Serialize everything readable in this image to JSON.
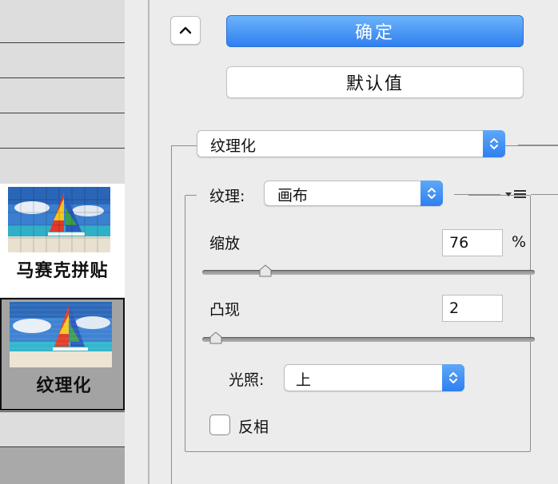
{
  "gallery": {
    "mosaic_label": "马赛克拼贴",
    "texture_label": "纹理化"
  },
  "buttons": {
    "ok_label": "确定",
    "default_label": "默认值"
  },
  "filter": {
    "selected": "纹理化"
  },
  "texture": {
    "label": "纹理:",
    "selected": "画布"
  },
  "scaling": {
    "label": "缩放",
    "value": "76",
    "unit": "%",
    "level": 0.19
  },
  "relief": {
    "label": "凸现",
    "value": "2",
    "level": 0.04
  },
  "light": {
    "label": "光照:",
    "selected": "上"
  },
  "invert": {
    "label": "反相",
    "checked": false
  },
  "colors": {
    "accent": "#2f7ff0",
    "panel": "#ececec"
  }
}
